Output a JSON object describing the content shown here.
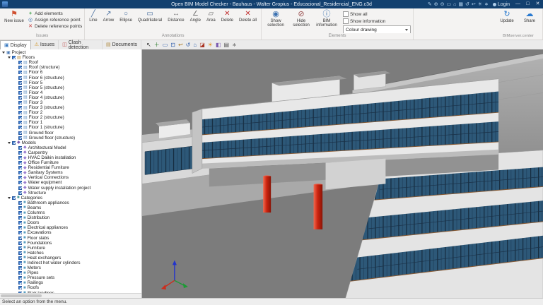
{
  "titlebar": {
    "title": "Open BIM Model Checker - Bauhaus - Walter Gropius - Educacional_Residencial_ENG.c3d",
    "login_label": "Login",
    "quick_icons": [
      {
        "name": "pencil-icon",
        "glyph": "✎"
      },
      {
        "name": "zoom-in-icon",
        "glyph": "⊕"
      },
      {
        "name": "zoom-out-icon",
        "glyph": "⊖"
      },
      {
        "name": "zoom-window-icon",
        "glyph": "▭"
      },
      {
        "name": "home-view-icon",
        "glyph": "⌂"
      },
      {
        "name": "views-grid-icon",
        "glyph": "▦"
      },
      {
        "name": "orbit-icon",
        "glyph": "↺"
      },
      {
        "name": "previous-view-icon",
        "glyph": "↩"
      },
      {
        "name": "sun-icon",
        "glyph": "☀"
      },
      {
        "name": "settings-icon",
        "glyph": "∗"
      }
    ],
    "window": {
      "minimize": "—",
      "maximize": "□",
      "close": "✕"
    }
  },
  "ribbon": {
    "issues": {
      "label": "Issues",
      "new_issue": "New issue",
      "new_issue_glyph": "⚑",
      "add_elements": "Add elements",
      "add_glyph": "+",
      "assign_reference": "Assign reference point",
      "assign_glyph": "◎",
      "delete_reference": "Delete reference points",
      "delete_glyph": "✕"
    },
    "annotations": {
      "label": "Annotations",
      "buttons": [
        {
          "name": "line",
          "glyph": "╱",
          "color": "#4a70a0",
          "label": "Line"
        },
        {
          "name": "arrow",
          "glyph": "↗",
          "color": "#4a70a0",
          "label": "Arrow"
        },
        {
          "name": "ellipse",
          "glyph": "○",
          "color": "#4a70a0",
          "label": "Ellipse"
        },
        {
          "name": "quadrilateral",
          "glyph": "▭",
          "color": "#4a70a0",
          "label": "Quadrilateral"
        },
        {
          "name": "distance",
          "glyph": "↔",
          "color": "#707070",
          "label": "Distance"
        },
        {
          "name": "angle",
          "glyph": "∠",
          "color": "#707070",
          "label": "Angle"
        },
        {
          "name": "area",
          "glyph": "▱",
          "color": "#707070",
          "label": "Area"
        },
        {
          "name": "delete",
          "glyph": "✕",
          "color": "#c03030",
          "label": "Delete"
        },
        {
          "name": "delete-all",
          "glyph": "✕",
          "color": "#c03030",
          "label": "Delete all"
        }
      ]
    },
    "elements": {
      "label": "Elements",
      "show_selection": "Show selection",
      "show_glyph": "◉",
      "hide_selection": "Hide selection",
      "hide_glyph": "⊘",
      "bim_information": "BIM information",
      "info_glyph": "ⓘ",
      "show_all": "Show all",
      "show_information": "Show information",
      "colour_drawing": "Colour drawing"
    },
    "bimserver": {
      "label": "BIMserver.center",
      "update": "Update",
      "update_glyph": "↻",
      "share": "Share",
      "share_glyph": "☁"
    }
  },
  "tabs": [
    {
      "name": "display",
      "label": "Display",
      "glyph": "▣",
      "color": "#3a7ac0",
      "active": true
    },
    {
      "name": "issues",
      "label": "Issues",
      "glyph": "⚠",
      "color": "#d09020",
      "active": false
    },
    {
      "name": "clash-detection",
      "label": "Clash detection",
      "glyph": "◫",
      "color": "#c05050",
      "active": false
    },
    {
      "name": "documents",
      "label": "Documents",
      "glyph": "▤",
      "color": "#b08a40",
      "active": false
    }
  ],
  "viewport_toolbar": [
    {
      "name": "select-icon",
      "glyph": "↖",
      "color": "#222222"
    },
    {
      "name": "pan-icon",
      "glyph": "＋",
      "color": "#2a7a2a"
    },
    {
      "name": "zoom-window-icon",
      "glyph": "▭",
      "color": "#2a5aaa"
    },
    {
      "name": "zoom-extents-icon",
      "glyph": "⊡",
      "color": "#2a5aaa"
    },
    {
      "name": "previous-view-icon",
      "glyph": "↩",
      "color": "#aa7722"
    },
    {
      "name": "orbit-icon",
      "glyph": "↺",
      "color": "#2a5aaa"
    },
    {
      "name": "home-view-icon",
      "glyph": "⌂",
      "color": "#2a5aaa"
    },
    {
      "name": "section-icon",
      "glyph": "◪",
      "color": "#aa3322"
    },
    {
      "name": "sun-icon",
      "glyph": "☀",
      "color": "#e09020"
    },
    {
      "name": "render-mode-icon",
      "glyph": "◧",
      "color": "#7a5ab0"
    },
    {
      "name": "print-icon",
      "glyph": "▤",
      "color": "#555555"
    },
    {
      "name": "settings-icon",
      "glyph": "∗",
      "color": "#777777"
    }
  ],
  "tree": {
    "root": "Project",
    "root_icon": "▣",
    "root_icon_color": "#4a7ab5",
    "sections": [
      {
        "label": "Floors",
        "icon": "▤",
        "icon_color": "#b5893a",
        "item_icon": "▤",
        "item_color": "#6f9cc6",
        "items": [
          "Roof",
          "Roof (structure)",
          "Floor 6",
          "Floor 6 (structure)",
          "Floor 5",
          "Floor 5 (structure)",
          "Floor 4",
          "Floor 4 (structure)",
          "Floor 3",
          "Floor 3 (structure)",
          "Floor 2",
          "Floor 2 (structure)",
          "Floor 1",
          "Floor 1 (structure)",
          "Ground floor",
          "Ground floor (structure)"
        ]
      },
      {
        "label": "Models",
        "icon": "◆",
        "icon_color": "#7a5ab0",
        "item_icon": "◆",
        "item_color": "#9b7fd0",
        "items": [
          "Architectural Model",
          "Carpentry",
          "HVAC Daikin installation",
          "Office Furniture",
          "Residential Furniture",
          "Sanitary Systems",
          "Vertical Connections",
          "Water equipment",
          "Water supply installation project",
          "Structure"
        ]
      },
      {
        "label": "Categories",
        "icon": "■",
        "icon_color": "#4a9a9a",
        "item_icon": "■",
        "item_color": "#5aa0c0",
        "items": [
          "Bathroom appliances",
          "Beams",
          "Columns",
          "Distribution",
          "Doors",
          "Electrical appliances",
          "Excavations",
          "Floor slabs",
          "Foundations",
          "Furniture",
          "Hatches",
          "Heat exchangers",
          "Indirect hot water cylinders",
          "Meters",
          "Pipes",
          "Pressure sets",
          "Railings",
          "Roofs",
          "Stair landings"
        ]
      }
    ]
  },
  "viewport": {
    "colors": {
      "background": "#7c7c7c",
      "wall": "#e8e8e8",
      "glazing": "#2d5878",
      "window_frame_brown": "#8a5a32",
      "column_red": "#cc2410",
      "rooftop_unit_cyan": "#3fb0c4",
      "axis_x_red": "#cc2d1d",
      "axis_y_green": "#1d9a35",
      "axis_z_blue": "#2233cc"
    }
  },
  "statusbar": {
    "message": "Select an option from the menu."
  }
}
